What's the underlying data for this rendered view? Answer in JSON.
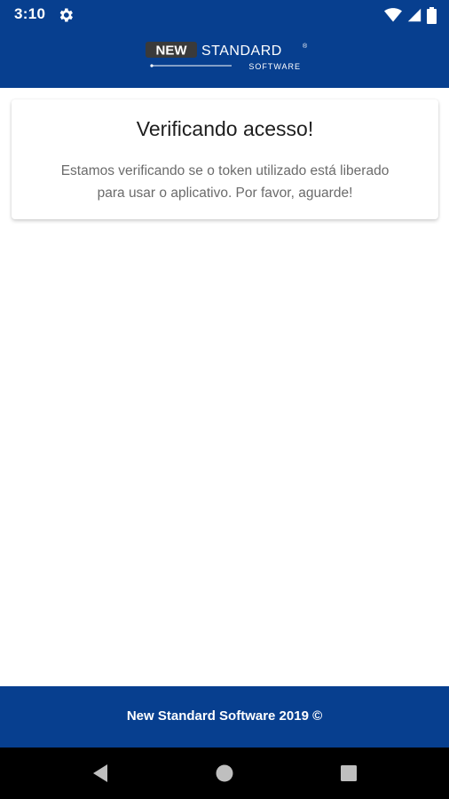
{
  "status_bar": {
    "time": "3:10",
    "icons": [
      "settings-gear-icon",
      "wifi-icon",
      "cell-signal-icon",
      "battery-icon"
    ]
  },
  "app_bar": {
    "logo_word1": "NEW",
    "logo_word2": "STANDARD",
    "logo_sub": "SOFTWARE",
    "logo_mark": "®",
    "color": "#073f8f"
  },
  "card": {
    "title": "Verificando acesso!",
    "message_line1": "Estamos verificando se o token utilizado está liberado",
    "message_line2": "para usar o aplicativo. Por favor, aguarde!"
  },
  "footer": {
    "text": "New Standard Software 2019 ©",
    "color": "#073f8f"
  },
  "nav_bar": {
    "buttons": [
      "back-icon",
      "home-icon",
      "recents-icon"
    ]
  }
}
